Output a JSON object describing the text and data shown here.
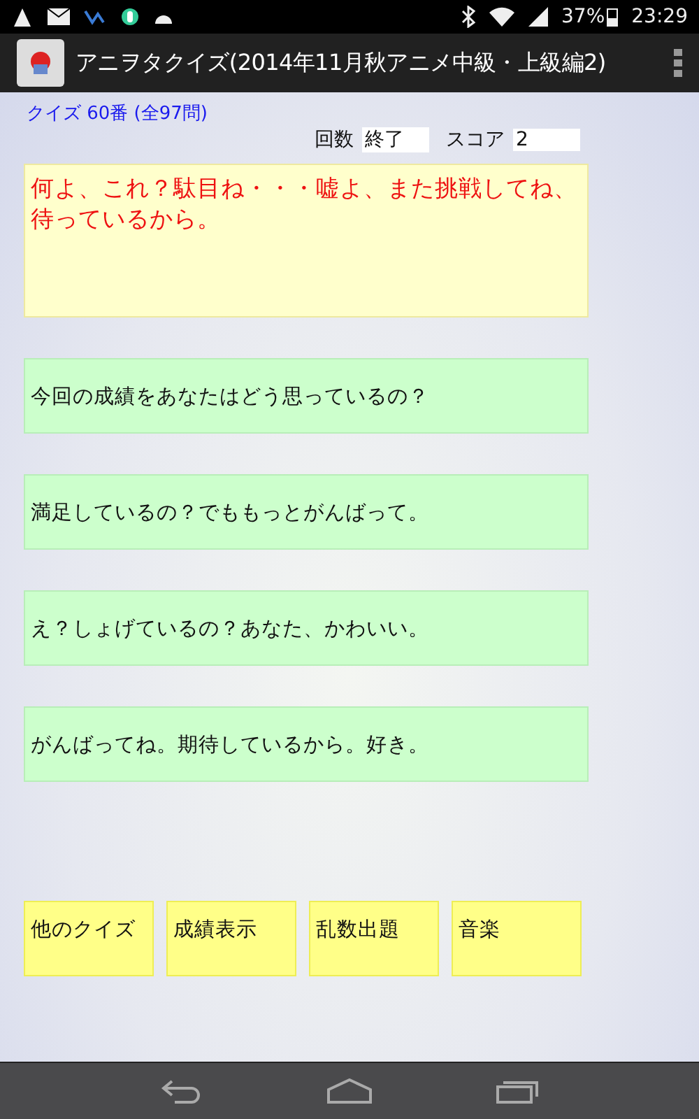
{
  "status_bar": {
    "battery": "37%",
    "time": "23:29"
  },
  "app_bar": {
    "title": "アニヲタクイズ(2014年11月秋アニメ中級・上級編2)"
  },
  "quiz_label": "クイズ 60番 (全97問)",
  "counters": [
    {
      "label": "回数",
      "value": "終了"
    },
    {
      "label": "スコア",
      "value": "2"
    }
  ],
  "message": "何よ、これ？駄目ね・・・嘘よ、また挑戦してね、待っているから。",
  "answers": [
    "今回の成績をあなたはどう思っているの？",
    "満足しているの？でももっとがんばって。",
    "え？しょげているの？あなた、かわいい。",
    "がんばってね。期待しているから。好き。"
  ],
  "buttons": [
    "他のクイズ",
    "成績表示",
    "乱数出題",
    "音楽"
  ]
}
